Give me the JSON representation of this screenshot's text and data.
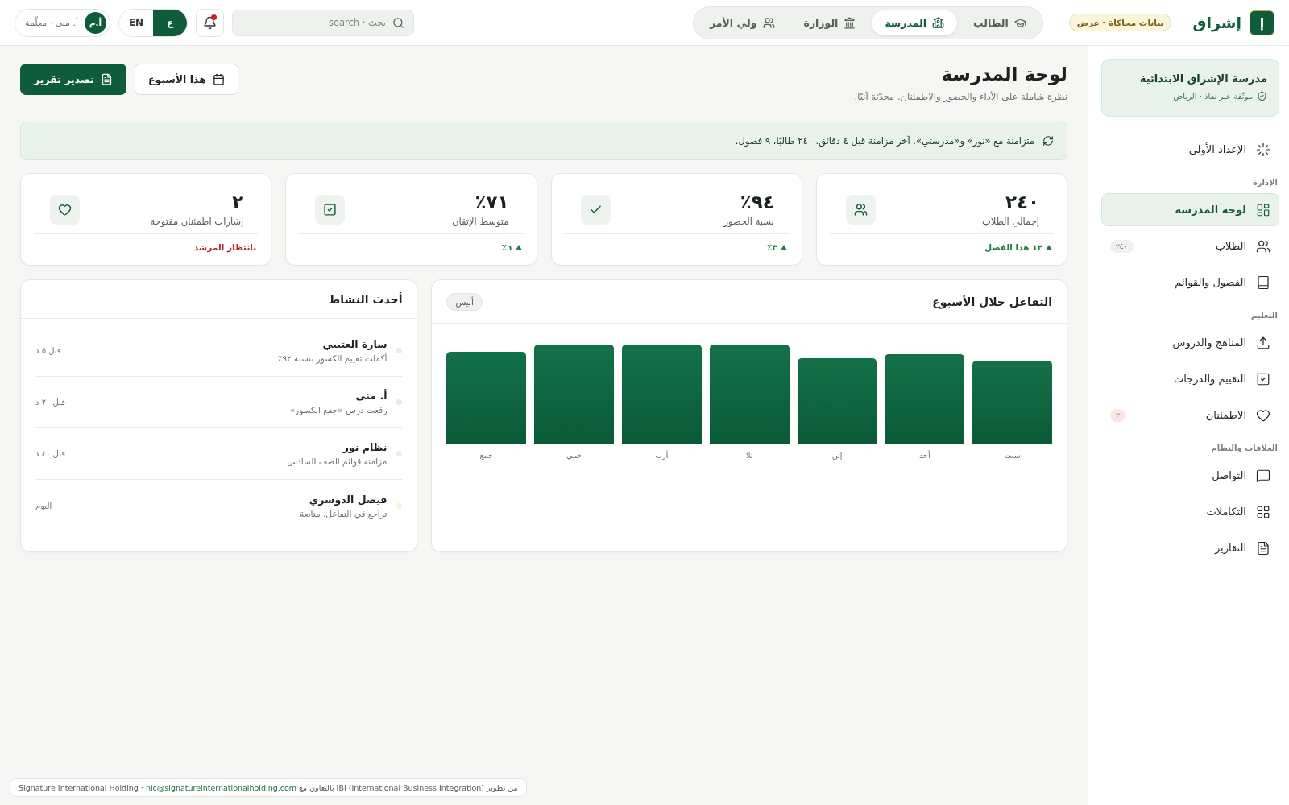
{
  "brand": {
    "logo": "إ",
    "name": "إشراق",
    "badge": "بيانات محاكاة · عرض"
  },
  "nav_tabs": [
    {
      "label": "الطالب",
      "selected": false
    },
    {
      "label": "المدرسة",
      "selected": true
    },
    {
      "label": "الوزارة",
      "selected": false
    },
    {
      "label": "ولي الأمر",
      "selected": false
    }
  ],
  "search": {
    "placeholder": "بحث · search"
  },
  "notifications": {
    "unread": true
  },
  "language": [
    {
      "label": "ع",
      "selected": true
    },
    {
      "label": "EN",
      "selected": false
    }
  ],
  "user": {
    "initials": "أ.م",
    "name": "أ. منى · معلّمة"
  },
  "sidebar": {
    "school": {
      "name": "مدرسة الإشراق الابتدائية",
      "note": "موثّقة عبر نفاذ · الرياض"
    },
    "items": [
      {
        "kind": "item",
        "label": "الإعداد الأولي",
        "selected": false
      },
      {
        "kind": "section",
        "label": "الإدارة"
      },
      {
        "kind": "item",
        "label": "لوحة المدرسة",
        "selected": true
      },
      {
        "kind": "item",
        "label": "الطلاب",
        "selected": false,
        "badge": "٢٤٠",
        "color": "#eef1ee"
      },
      {
        "kind": "item",
        "label": "الفصول والقوائم",
        "selected": false
      },
      {
        "kind": "section",
        "label": "التعليم"
      },
      {
        "kind": "item",
        "label": "المناهج والدروس",
        "selected": false
      },
      {
        "kind": "item",
        "label": "التقييم والدرجات",
        "selected": false
      },
      {
        "kind": "item",
        "label": "الاطمئنان",
        "selected": false,
        "badge": "٢",
        "color": "#fbe6e6"
      },
      {
        "kind": "section",
        "label": "العلاقات والنظام"
      },
      {
        "kind": "item",
        "label": "التواصل",
        "selected": false
      },
      {
        "kind": "item",
        "label": "التكاملات",
        "selected": false
      },
      {
        "kind": "item",
        "label": "التقارير",
        "selected": false
      }
    ]
  },
  "page": {
    "title": "لوحة المدرسة",
    "subtitle": "نظرة شاملة على الأداء والحضور والاطمئنان. محدّثة آنيًا.",
    "buttons": [
      {
        "label": "هذا الأسبوع",
        "kind": "secondary"
      },
      {
        "label": "تصدير تقرير",
        "kind": "primary"
      }
    ]
  },
  "sync_banner": "متزامنة مع «نور» و«مدرستي». آخر مزامنة قبل ٤ دقائق. ٢٤٠ طالبًا، ٩ فصول.",
  "kpis": [
    {
      "value": "٢٤٠",
      "label": "إجمالي الطلاب",
      "trend": "١٢ هذا الفصل",
      "kind": "up"
    },
    {
      "value": "٩٤٪",
      "label": "نسبة الحضور",
      "trend": "٣٪",
      "kind": "up"
    },
    {
      "value": "٧١٪",
      "label": "متوسط الإتقان",
      "trend": "٦٪",
      "kind": "up"
    },
    {
      "value": "٢",
      "label": "إشارات اطمئنان مفتوحة",
      "trend": "بانتظار المرشد",
      "kind": "alert"
    }
  ],
  "engagement": {
    "title": "التفاعل خلال الأسبوع",
    "tag": "أنيس",
    "days": [
      "سبت",
      "أحد",
      "إثن",
      "ثلا",
      "أرب",
      "خمي",
      "جمع"
    ]
  },
  "activity": {
    "title": "أحدث النشاط",
    "items": [
      {
        "name": "سارة العتيبي",
        "detail": "أكملت تقييم الكسور بنسبة ٩٢٪",
        "time": "قبل ٥ د",
        "color": "#e3efe8"
      },
      {
        "name": "أ. منى",
        "detail": "رفعت درس «جمع الكسور»",
        "time": "قبل ٢٠ د",
        "color": "#e6e6f6"
      },
      {
        "name": "نظام نور",
        "detail": "مزامنة قوائم الصف السادس",
        "time": "قبل ٤٠ د",
        "color": "#eaeeea"
      },
      {
        "name": "فيصل الدوسري",
        "detail": "تراجع في التفاعل. متابعة",
        "time": "اليوم",
        "color": "#fbf0d8"
      }
    ]
  },
  "footer": {
    "before": "من تطوير IBI (International Business Integration) بالتعاون مع",
    "link": "nic@signatureinternationalholding.com",
    "after": "· Signature International Holding"
  }
}
